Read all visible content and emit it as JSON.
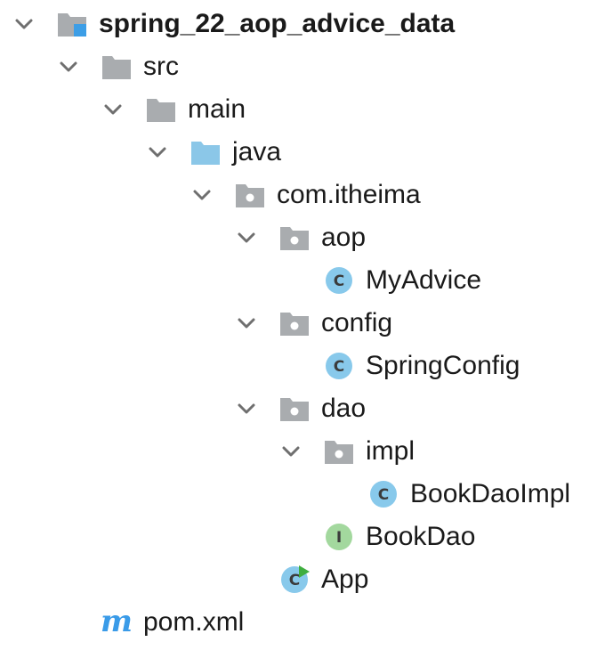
{
  "project_tree": {
    "root": {
      "label": "spring_22_aop_advice_data",
      "expanded": true,
      "icon": "module-folder-icon",
      "children": [
        {
          "label": "src",
          "expanded": true,
          "icon": "folder-icon",
          "children": [
            {
              "label": "main",
              "expanded": true,
              "icon": "folder-icon",
              "children": [
                {
                  "label": "java",
                  "expanded": true,
                  "icon": "source-root-folder-icon",
                  "children": [
                    {
                      "label": "com.itheima",
                      "expanded": true,
                      "icon": "package-icon",
                      "children": [
                        {
                          "label": "aop",
                          "expanded": true,
                          "icon": "package-icon",
                          "children": [
                            {
                              "label": "MyAdvice",
                              "icon": "class-icon"
                            }
                          ]
                        },
                        {
                          "label": "config",
                          "expanded": true,
                          "icon": "package-icon",
                          "children": [
                            {
                              "label": "SpringConfig",
                              "icon": "class-icon"
                            }
                          ]
                        },
                        {
                          "label": "dao",
                          "expanded": true,
                          "icon": "package-icon",
                          "children": [
                            {
                              "label": "impl",
                              "expanded": true,
                              "icon": "package-icon",
                              "children": [
                                {
                                  "label": "BookDaoImpl",
                                  "icon": "class-icon"
                                }
                              ]
                            },
                            {
                              "label": "BookDao",
                              "icon": "interface-icon"
                            }
                          ]
                        },
                        {
                          "label": "App",
                          "icon": "runnable-class-icon"
                        }
                      ]
                    }
                  ]
                }
              ]
            }
          ]
        },
        {
          "label": "pom.xml",
          "icon": "maven-pom-icon"
        }
      ]
    }
  },
  "icon_glyphs": {
    "class": "C",
    "interface": "I",
    "maven": "m"
  },
  "colors": {
    "folder_gray": "#a9acaf",
    "source_root_blue": "#8bc7e8",
    "module_blue": "#3d9ee6",
    "class_blue": "#88c9eb",
    "interface_green": "#a3d89e",
    "run_green": "#3fae3f",
    "maven_blue": "#3a9be8",
    "text": "#1a1a1a",
    "chevron": "#6f6f6f"
  }
}
